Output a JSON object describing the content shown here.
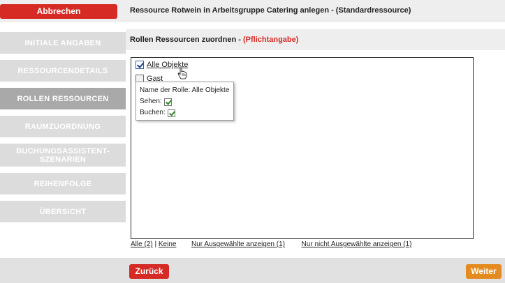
{
  "sidebar": {
    "cancel_label": "Abbrechen",
    "steps": [
      {
        "label": "INITIALE ANGABEN"
      },
      {
        "label": "RESSOURCENDETAILS"
      },
      {
        "label": "ROLLEN RESSOURCEN"
      },
      {
        "label": "RAUMZUORDNUNG"
      },
      {
        "label": "BUCHUNGSASSISTENT-SZENARIEN"
      },
      {
        "label": "REIHENFOLGE"
      },
      {
        "label": "ÜBERSICHT"
      }
    ],
    "active_step": "ROLLEN RESSOURCEN"
  },
  "header": {
    "title": "Ressource Rotwein in Arbeitsgruppe Catering anlegen - (Standardressource)"
  },
  "section": {
    "title": "Rollen Ressourcen zuordnen - ",
    "required": "(Pflichtangabe)"
  },
  "roles": [
    {
      "label": "Alle Objekte",
      "checked": true
    },
    {
      "label": "Gast",
      "checked": false
    }
  ],
  "tooltip": {
    "role_line": "Name der Rolle: Alle Objekte",
    "see_label": "Sehen:",
    "book_label": "Buchen:"
  },
  "filters": {
    "all": "Alle (2)",
    "sep": "|",
    "none": "Keine",
    "only_selected": "Nur Ausgewählte anzeigen (1)",
    "only_unselected": "Nur nicht Ausgewählte anzeigen (1)"
  },
  "footer": {
    "back_label": "Zurück",
    "next_label": "Weiter"
  },
  "colors": {
    "accent_red": "#d62b25",
    "accent_orange": "#e38b1f",
    "step_inactive": "#dcdcdc",
    "step_active": "#a9a9a9"
  }
}
